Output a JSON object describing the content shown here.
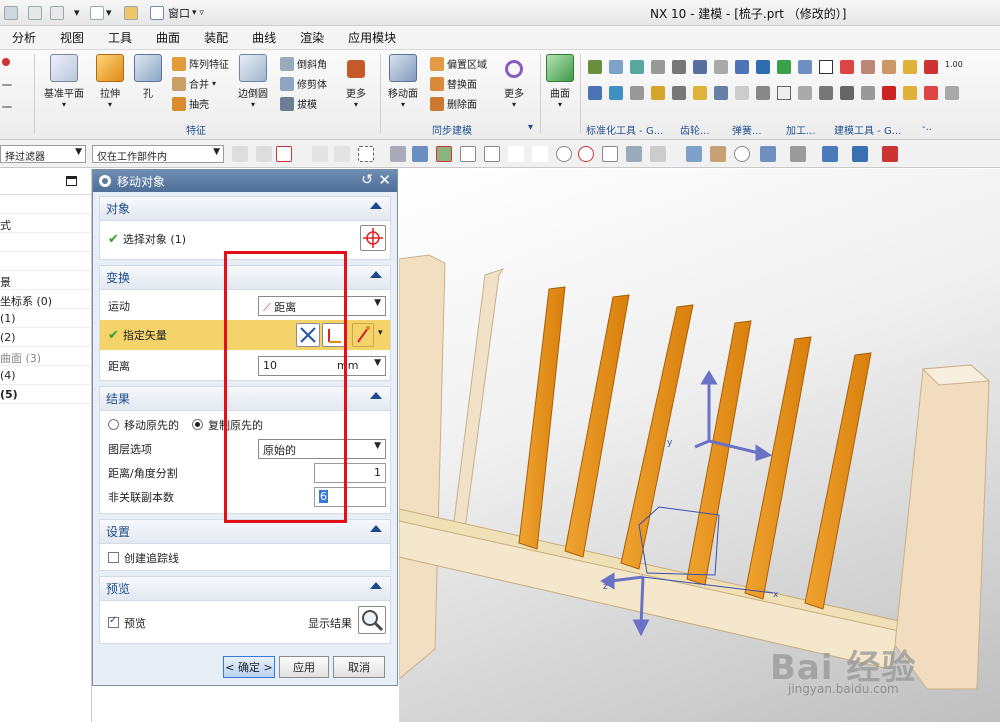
{
  "window": {
    "title": "NX 10 - 建模 - [梳子.prt （修改的）]"
  },
  "quick_access": {
    "window_menu": "窗口"
  },
  "menubar": {
    "items": [
      "分析",
      "视图",
      "工具",
      "曲面",
      "装配",
      "曲线",
      "渲染",
      "应用模块"
    ]
  },
  "ribbon": {
    "feature": {
      "datum_plane": "基准平面",
      "extrude": "拉伸",
      "hole": "孔",
      "pattern": "阵列特征",
      "unite": "合并",
      "shell": "抽壳",
      "edge_blend": "边倒圆",
      "chamfer": "倒斜角",
      "trim_body": "修剪体",
      "draft": "拔模",
      "more": "更多",
      "group_label": "特征"
    },
    "sync": {
      "move_face": "移动面",
      "offset_region": "偏置区域",
      "replace_face": "替换面",
      "delete_face": "删除面",
      "more": "更多",
      "group_label": "同步建模"
    },
    "surface": {
      "label": "曲面"
    },
    "groups": [
      "标准化工具 - G...",
      "齿轮...",
      "弹簧...",
      "加工...",
      "建模工具 - G...",
      "-.."
    ],
    "size_label": "1.00"
  },
  "toolbar2": {
    "filter_label": "择过滤器",
    "scope": "仅在工作部件内"
  },
  "navigator": {
    "rows": [
      {
        "text": "",
        "style": ""
      },
      {
        "text": "式",
        "style": ""
      },
      {
        "text": "",
        "style": ""
      },
      {
        "text": "",
        "style": ""
      },
      {
        "text": "景",
        "style": ""
      },
      {
        "text": "坐标系 (0)",
        "style": ""
      },
      {
        "text": "(1)",
        "style": ""
      },
      {
        "text": "(2)",
        "style": ""
      },
      {
        "text": "曲面 (3)",
        "style": "gray"
      },
      {
        "text": "(4)",
        "style": ""
      },
      {
        "text": "(5)",
        "style": "bold"
      }
    ]
  },
  "dialog": {
    "title": "移动对象",
    "object": {
      "header": "对象",
      "select_label": "选择对象 (1)"
    },
    "transform": {
      "header": "变换",
      "motion_label": "运动",
      "motion_value": "距离",
      "vector_label": "指定矢量",
      "distance_label": "距离",
      "distance_value": "10",
      "distance_unit": "mm"
    },
    "result": {
      "header": "结果",
      "move_original": "移动原先的",
      "copy_original": "复制原先的",
      "layer_label": "图层选项",
      "layer_value": "原始的",
      "split_label": "距离/角度分割",
      "split_value": "1",
      "copies_label": "非关联副本数",
      "copies_value": "6"
    },
    "settings": {
      "header": "设置",
      "trace_label": "创建追踪线"
    },
    "preview": {
      "header": "预览",
      "preview_label": "预览",
      "show_result": "显示结果"
    },
    "buttons": {
      "ok": "< 确定 >",
      "apply": "应用",
      "cancel": "取消"
    }
  },
  "watermark": {
    "brand": "Bai 经验",
    "url": "jingyan.baidu.com"
  },
  "colors": {
    "accent": "#f5d36b",
    "tine": "#e8920f",
    "annotation": "#e3101a",
    "header_text": "#1c4b8c"
  }
}
